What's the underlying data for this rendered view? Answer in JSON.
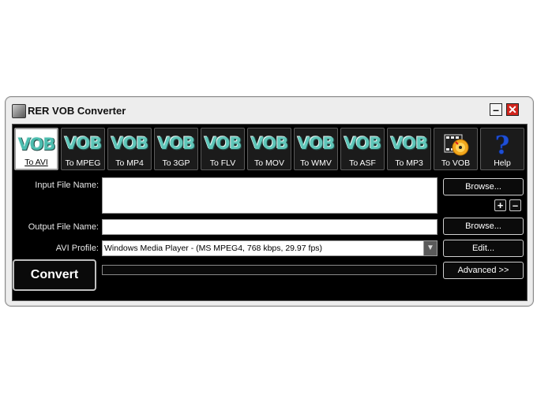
{
  "window": {
    "title": "RER VOB Converter",
    "minimize_label": "–",
    "close_label": "✕"
  },
  "tabs": [
    {
      "vob": "VOB",
      "label": "To AVI",
      "active": true
    },
    {
      "vob": "VOB",
      "label": "To MPEG",
      "active": false
    },
    {
      "vob": "VOB",
      "label": "To MP4",
      "active": false
    },
    {
      "vob": "VOB",
      "label": "To 3GP",
      "active": false
    },
    {
      "vob": "VOB",
      "label": "To FLV",
      "active": false
    },
    {
      "vob": "VOB",
      "label": "To MOV",
      "active": false
    },
    {
      "vob": "VOB",
      "label": "To WMV",
      "active": false
    },
    {
      "vob": "VOB",
      "label": "To ASF",
      "active": false
    },
    {
      "vob": "VOB",
      "label": "To MP3",
      "active": false
    },
    {
      "icon": "film-disc-icon",
      "label": "To VOB",
      "active": false
    },
    {
      "icon": "help-icon",
      "label": "Help",
      "active": false
    }
  ],
  "form": {
    "input_label": "Input File Name:",
    "input_value": "",
    "output_label": "Output File Name:",
    "output_value": "",
    "profile_label": "AVI Profile:",
    "profile_value": "Windows Media Player - (MS MPEG4, 768 kbps, 29.97 fps)"
  },
  "buttons": {
    "browse_input": "Browse...",
    "browse_output": "Browse...",
    "edit": "Edit...",
    "advanced": "Advanced >>",
    "add": "+",
    "remove": "–",
    "convert": "Convert"
  },
  "progress": 0,
  "colors": {
    "panel": "#000000",
    "vob_text": "#5fc6b9",
    "close": "#d0241c"
  }
}
